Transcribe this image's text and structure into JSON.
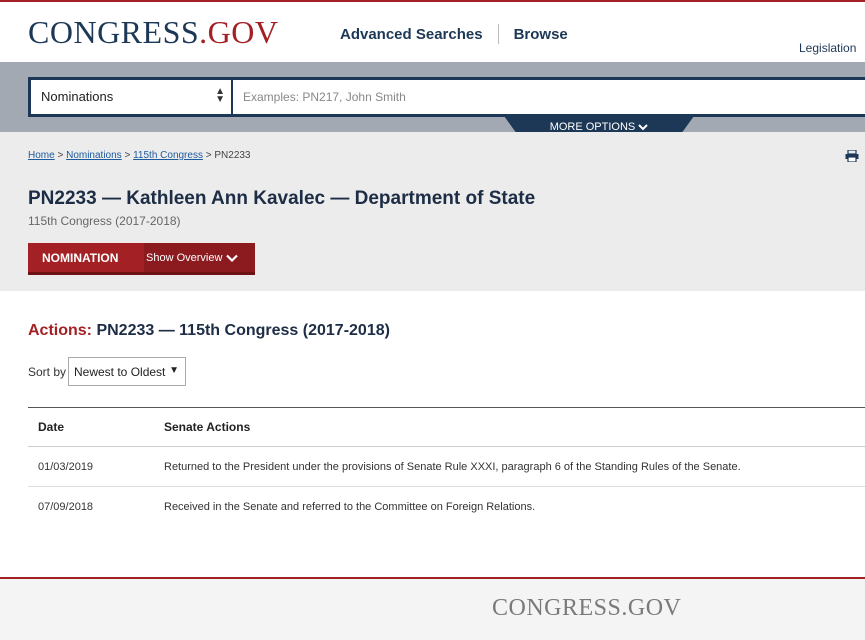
{
  "header": {
    "logo_part1": "CONGRESS",
    "logo_part2": ".GOV",
    "nav": [
      "Advanced Searches",
      "Browse"
    ],
    "legislation_link": "Legislation"
  },
  "search": {
    "collection": "Nominations",
    "placeholder": "Examples: PN217, John Smith",
    "more_options": "MORE OPTIONS",
    "more_options_icon": "chevron-down-icon"
  },
  "breadcrumb": {
    "items": [
      "Home",
      "Nominations",
      "115th Congress"
    ],
    "current": "PN2233",
    "separator": ">"
  },
  "nomination": {
    "title": "PN2233 — Kathleen Ann Kavalec — Department of State",
    "congress": "115th Congress (2017-2018)",
    "tab_label": "NOMINATION",
    "show_overview": "Show Overview"
  },
  "actions": {
    "heading_prefix": "Actions:",
    "heading_rest": "PN2233 — 115th Congress (2017-2018)",
    "sort_label": "Sort by",
    "sort_value": "Newest to Oldest",
    "columns": [
      "Date",
      "Senate Actions"
    ],
    "rows": [
      {
        "date": "01/03/2019",
        "action": "Returned to the President under the provisions of Senate Rule XXXI, paragraph 6 of the Standing Rules of the Senate."
      },
      {
        "date": "07/09/2018",
        "action": "Received in the Senate and referred to the Committee on Foreign Relations."
      }
    ]
  },
  "footer": {
    "logo": "CONGRESS.GOV"
  },
  "colors": {
    "brand_red": "#a32125",
    "brand_navy": "#1d3856"
  }
}
